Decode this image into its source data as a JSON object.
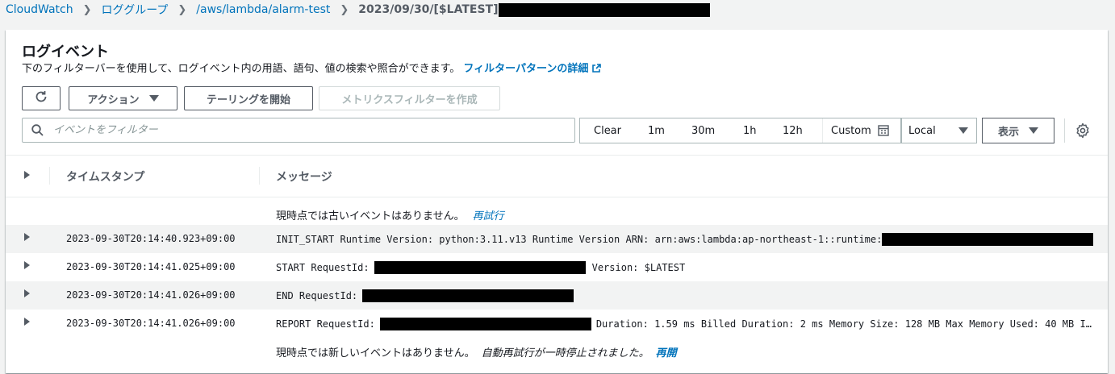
{
  "breadcrumb": {
    "items": [
      "CloudWatch",
      "ロググループ",
      "/aws/lambda/alarm-test"
    ],
    "current": "2023/09/30/[$LATEST]"
  },
  "panel": {
    "title": "ログイベント",
    "description": "下のフィルターバーを使用して、ログイベント内の用語、語句、値の検索や照合ができます。",
    "filter_link": "フィルターパターンの詳細"
  },
  "toolbar": {
    "refresh_icon": "refresh-icon",
    "actions_label": "アクション",
    "tail_label": "テーリングを開始",
    "metric_filter_label": "メトリクスフィルターを作成"
  },
  "search": {
    "placeholder": "イベントをフィルター"
  },
  "time_range": {
    "options": [
      "Clear",
      "1m",
      "30m",
      "1h",
      "12h"
    ],
    "custom_label": "Custom"
  },
  "timezone": {
    "selected": "Local"
  },
  "display": {
    "label": "表示"
  },
  "table": {
    "columns": [
      "タイムスタンプ",
      "メッセージ"
    ],
    "top_notice": {
      "text": "現時点では古いイベントはありません。",
      "link": "再試行"
    },
    "rows": [
      {
        "timestamp": "2023-09-30T20:14:40.923+09:00",
        "message": "INIT_START Runtime Version: python:3.11.v13 Runtime Version ARN: arn:aws:lambda:ap-northeast-1::runtime:"
      },
      {
        "timestamp": "2023-09-30T20:14:41.025+09:00",
        "message": "START RequestId:",
        "message_suffix": "Version: $LATEST"
      },
      {
        "timestamp": "2023-09-30T20:14:41.026+09:00",
        "message": "END RequestId:"
      },
      {
        "timestamp": "2023-09-30T20:14:41.026+09:00",
        "message": "REPORT RequestId:",
        "message_suffix": "Duration: 1.59 ms Billed Duration: 2 ms Memory Size: 128 MB Max Memory Used: 40 MB I…"
      }
    ],
    "bottom_notice": {
      "text": "現時点では新しいイベントはありません。",
      "paused": "自動再試行が一時停止されました。",
      "link": "再開"
    }
  },
  "colors": {
    "link": "#0073bb",
    "text": "#16191f",
    "muted": "#545b64",
    "background": "#f2f3f3"
  }
}
